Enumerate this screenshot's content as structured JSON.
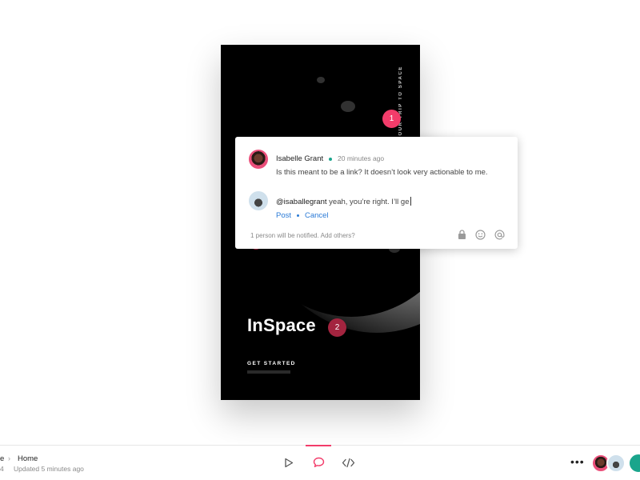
{
  "artboard": {
    "vertical_tag": "YOUR TRIP TO SPACE",
    "brand": "InSpace",
    "badge_number": "2",
    "cta": "GET STARTED"
  },
  "pin": {
    "number": "1"
  },
  "comment": {
    "author": "Isabelle Grant",
    "time": "20 minutes ago",
    "body": "Is this meant to be a link? It doesn’t look very actionable to me.",
    "reply_mention": "@isaballegrant",
    "reply_rest": " yeah, you’re right. I’ll ge",
    "post_label": "Post",
    "cancel_label": "Cancel",
    "notify_text": "1 person will be notified. Add others?",
    "tools": [
      "lock-icon",
      "emoji-icon",
      "at-icon"
    ]
  },
  "bottombar": {
    "crumb_prev": "e",
    "crumb_current": "Home",
    "crumb_extra": "4",
    "updated": "Updated 5 minutes ago",
    "modes": [
      "play-icon",
      "comment-icon",
      "code-icon"
    ],
    "active_mode": "comment-icon",
    "more_label": "•••"
  },
  "colors": {
    "accent": "#f23c6a",
    "link": "#2a7ad6",
    "online": "#1aa58c",
    "badge": "#a3243f"
  }
}
